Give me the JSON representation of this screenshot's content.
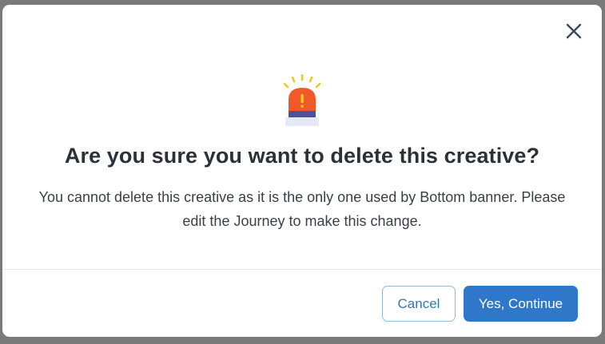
{
  "dialog": {
    "title": "Are you sure you want to delete this creative?",
    "message": "You cannot delete this creative as it is the only one used by Bottom banner. Please edit the Journey to make this change.",
    "alert_icon": "siren-alert-icon",
    "close_icon": "close-icon"
  },
  "buttons": {
    "cancel_label": "Cancel",
    "confirm_label": "Yes, Continue"
  },
  "colors": {
    "primary": "#2f78c9",
    "siren_red": "#f05a28",
    "siren_glow": "#f5c518",
    "siren_base": "#4a5394"
  }
}
